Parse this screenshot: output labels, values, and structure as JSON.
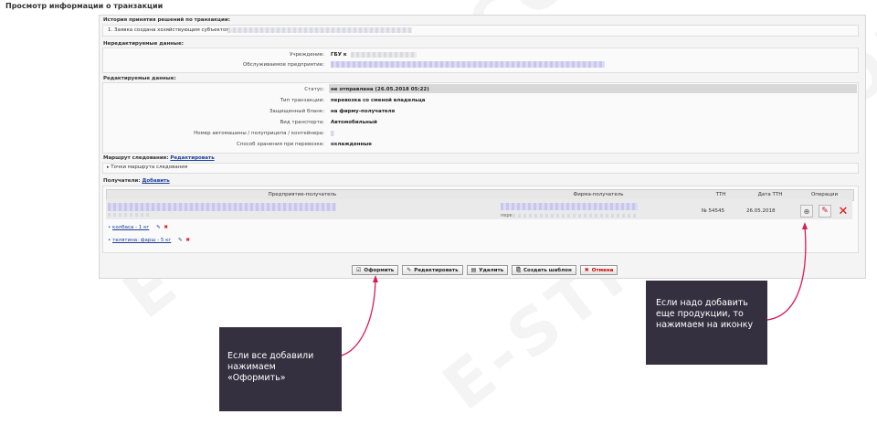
{
  "page_title": "Просмотр информации о транзакции",
  "history": {
    "header": "История принятия решений по транзакции:",
    "entry": "1. Заявка создана хозяйствующим субъектом :"
  },
  "non_editable": {
    "header": "Нередактируемые данные:",
    "institution_label": "Учреждение:",
    "institution_value": "ГБУ к",
    "enterprise_label": "Обслуживаемое предприятие:"
  },
  "editable": {
    "header": "Редактируемые данные:",
    "fields": [
      {
        "label": "Статус:",
        "value": "не отправлена (26.05.2018 05:22)"
      },
      {
        "label": "Тип транзакции:",
        "value": "перевозка со сменой владельца"
      },
      {
        "label": "Защищенный бланк:",
        "value": "на фирму-получателя"
      },
      {
        "label": "Вид транспорта:",
        "value": "Автомобильный"
      },
      {
        "label": "Номер автомашины / полуприцепа / контейнера:",
        "value": ""
      },
      {
        "label": "Способ хранения при перевозке:",
        "value": "охлажденные"
      }
    ]
  },
  "route": {
    "label": "Маршрут следования:",
    "edit_link": "Редактировать",
    "points_toggle": "Точки маршрута следования"
  },
  "recipients": {
    "label": "Получатели:",
    "add_link": "Добавить",
    "columns": [
      "Предприятие-получатель",
      "Фирма-получатель",
      "ТТН",
      "Дата ТТН",
      "Операции"
    ],
    "row": {
      "firm_prefix": "перев",
      "ttn": "№ 54545",
      "date": "26.05.2018"
    },
    "products": [
      "колбаса - 1 кг",
      "телятина: фарш - 5 кг"
    ]
  },
  "buttons": {
    "submit": "Оформить",
    "edit": "Редактировать",
    "delete": "Удалить",
    "template": "Создать шаблон",
    "cancel": "Отмена"
  },
  "callouts": {
    "left": [
      "Если  все добавили",
      "нажимаем «Оформить»"
    ],
    "right": [
      "Если надо добавить",
      "еще продукции, то",
      "нажимаем на иконку"
    ]
  },
  "watermark": "E-STRANA.COM",
  "colors": {
    "accent_link": "#1a3f9c",
    "callout_bg": "#35303f",
    "arrow": "#d81b57",
    "delete_red": "#e01010"
  }
}
